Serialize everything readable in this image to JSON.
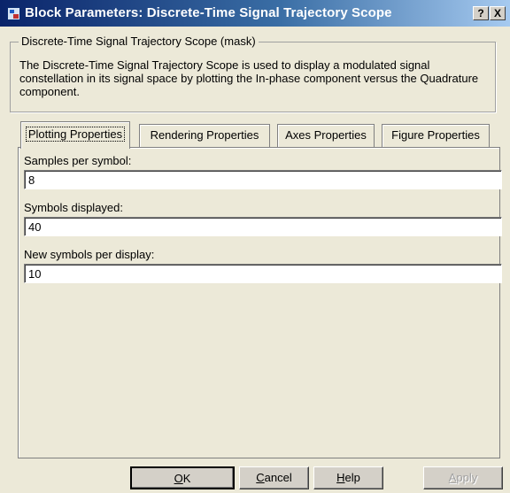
{
  "window": {
    "title": "Block Parameters: Discrete-Time Signal Trajectory Scope",
    "help_glyph": "?",
    "close_glyph": "X"
  },
  "mask": {
    "title": "Discrete-Time Signal Trajectory Scope (mask)",
    "description": "The Discrete-Time Signal Trajectory Scope is used to display a modulated signal constellation in its signal space by plotting the In-phase component versus the Quadrature component."
  },
  "tabs": [
    {
      "label": "Plotting Properties",
      "active": true
    },
    {
      "label": "Rendering Properties",
      "active": false
    },
    {
      "label": "Axes Properties",
      "active": false
    },
    {
      "label": "Figure Properties",
      "active": false
    }
  ],
  "fields": [
    {
      "label": "Samples per symbol:",
      "value": "8"
    },
    {
      "label": "Symbols displayed:",
      "value": "40"
    },
    {
      "label": "New symbols per display:",
      "value": "10"
    }
  ],
  "buttons": {
    "ok": {
      "accel": "O",
      "rest": "K"
    },
    "cancel": {
      "accel": "C",
      "rest": "ancel"
    },
    "help": {
      "accel": "H",
      "rest": "elp"
    },
    "apply": {
      "accel": "A",
      "rest": "pply"
    }
  },
  "colors": {
    "titlebar_start": "#0a246a",
    "titlebar_end": "#a6caf0",
    "dialog_bg": "#ece9d8"
  }
}
